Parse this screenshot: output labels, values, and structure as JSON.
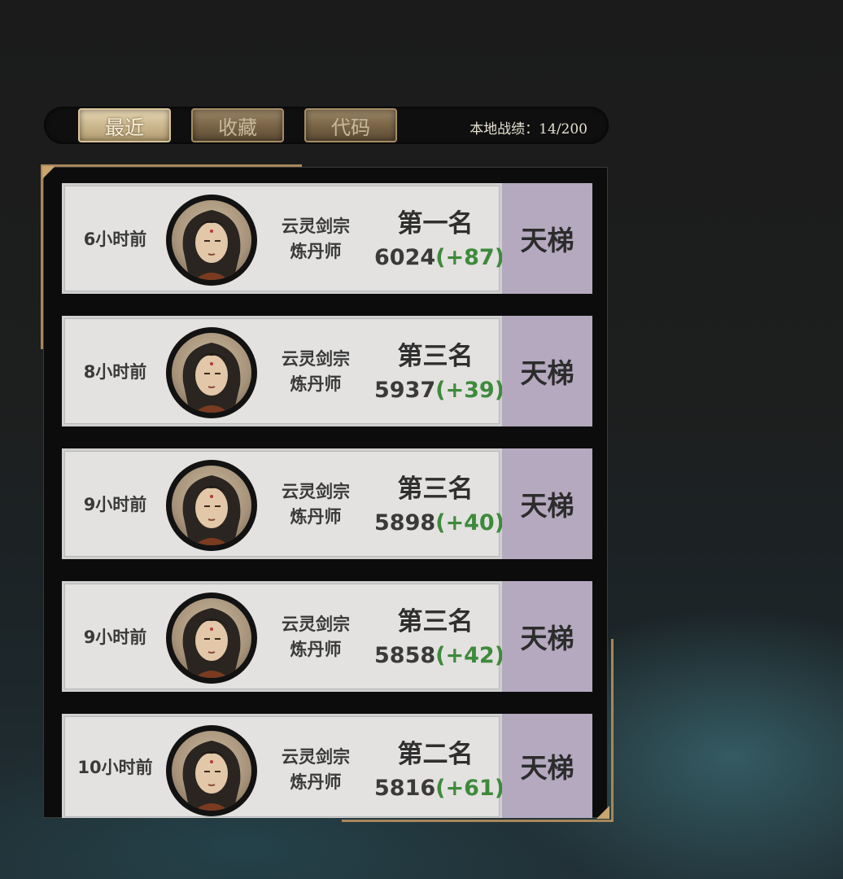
{
  "tabs": [
    {
      "label": "最近",
      "active": true
    },
    {
      "label": "收藏",
      "active": false
    },
    {
      "label": "代码",
      "active": false
    }
  ],
  "local_record": "本地战绩：14/200",
  "records": [
    {
      "time": "6小时前",
      "sect": "云灵剑宗",
      "role": "炼丹师",
      "rank": "第一名",
      "score": "6024",
      "delta": "(+87)",
      "mode": "天梯"
    },
    {
      "time": "8小时前",
      "sect": "云灵剑宗",
      "role": "炼丹师",
      "rank": "第三名",
      "score": "5937",
      "delta": "(+39)",
      "mode": "天梯"
    },
    {
      "time": "9小时前",
      "sect": "云灵剑宗",
      "role": "炼丹师",
      "rank": "第三名",
      "score": "5898",
      "delta": "(+40)",
      "mode": "天梯"
    },
    {
      "time": "9小时前",
      "sect": "云灵剑宗",
      "role": "炼丹师",
      "rank": "第三名",
      "score": "5858",
      "delta": "(+42)",
      "mode": "天梯"
    },
    {
      "time": "10小时前",
      "sect": "云灵剑宗",
      "role": "炼丹师",
      "rank": "第二名",
      "score": "5816",
      "delta": "(+61)",
      "mode": "天梯"
    }
  ],
  "colors": {
    "accent_gold": "#a8875a",
    "delta_green": "#3e8a3c",
    "mode_badge": "#b4a9be"
  },
  "icons": {
    "avatar": "character-portrait-icon"
  }
}
